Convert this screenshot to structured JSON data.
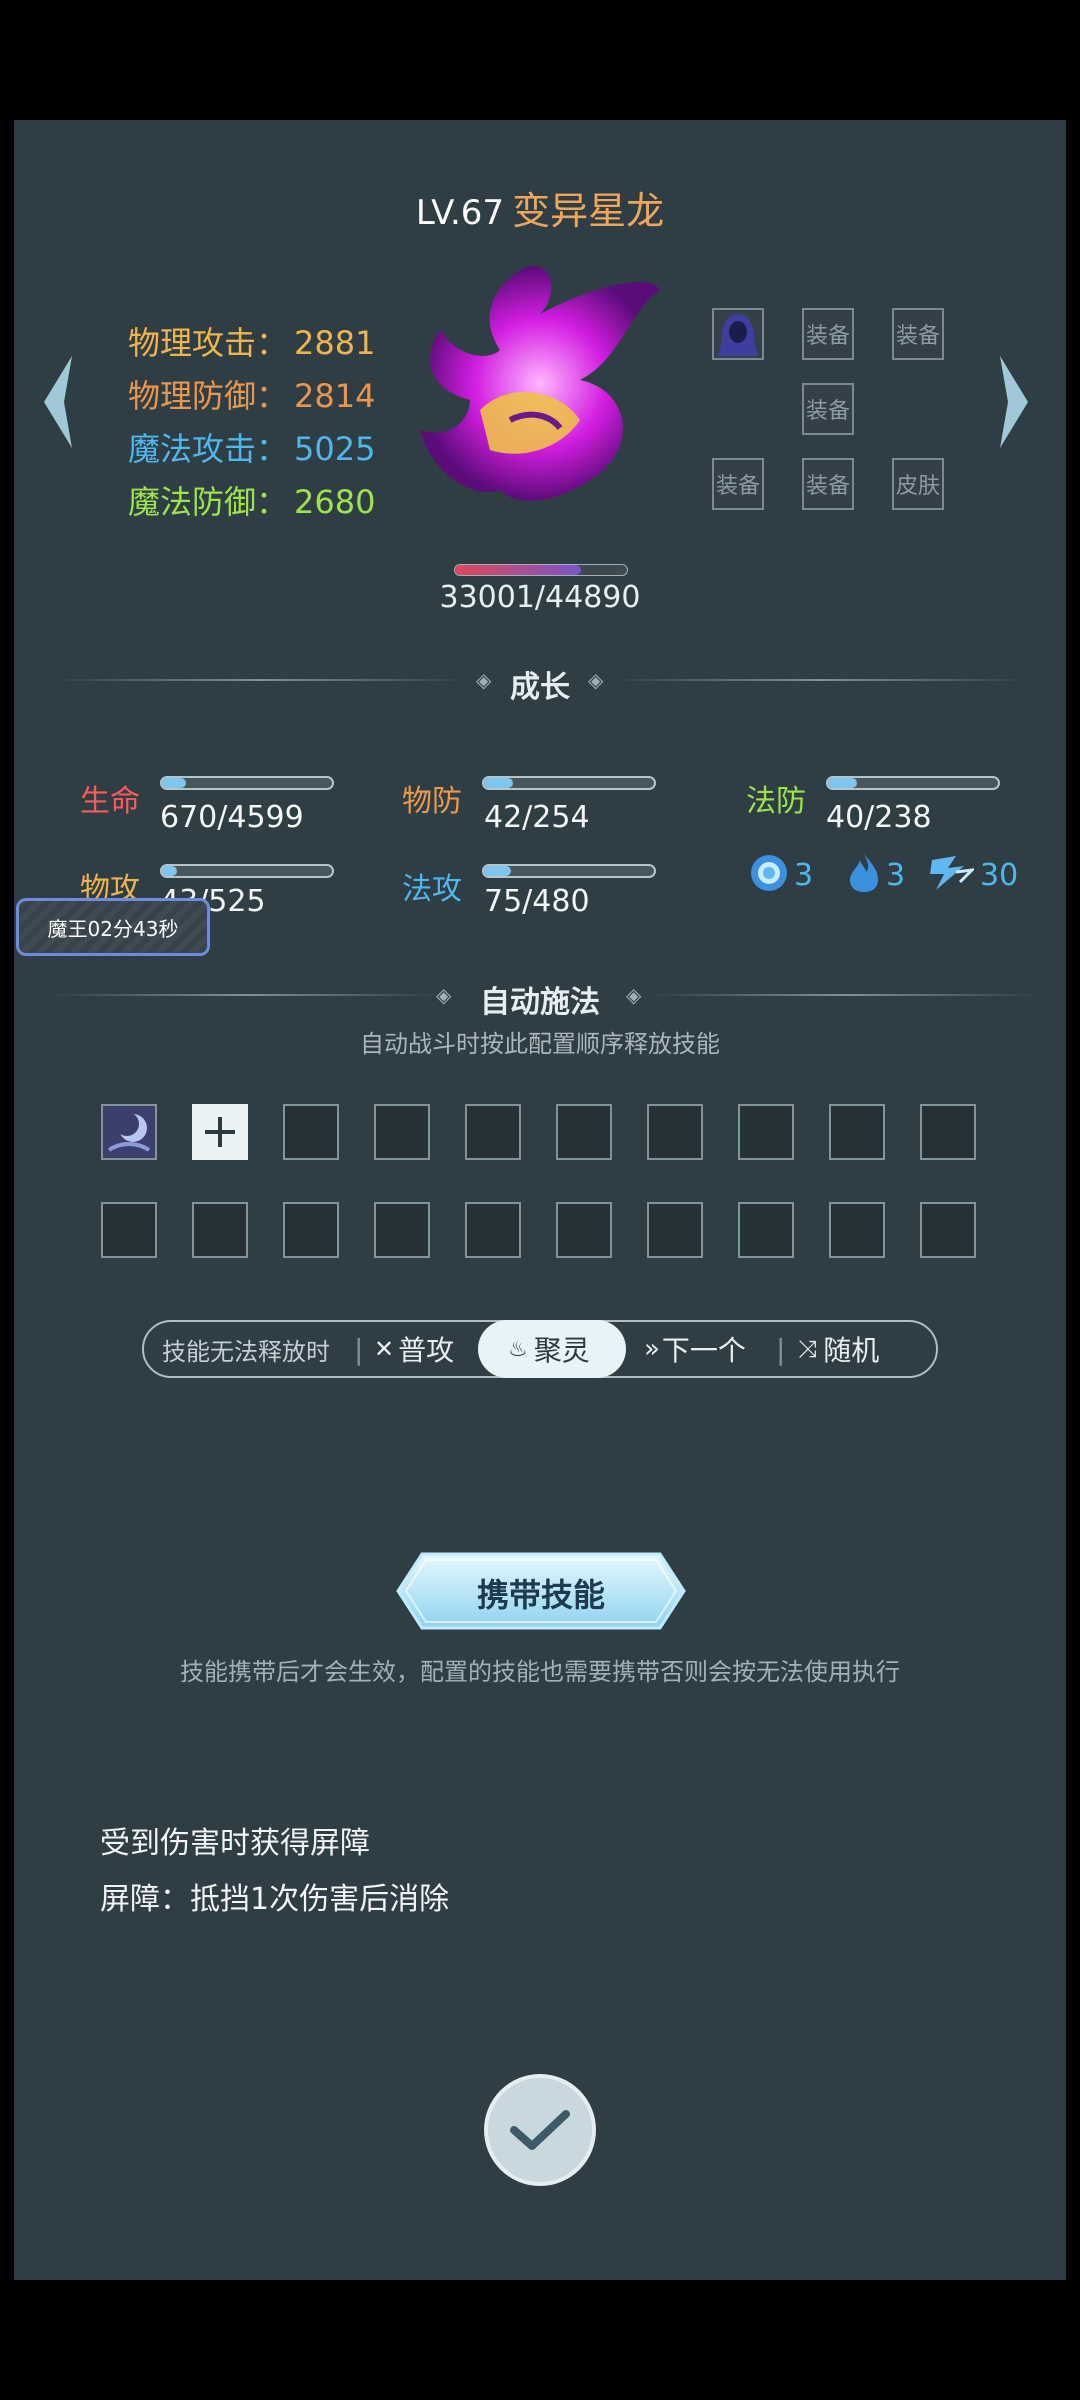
{
  "header": {
    "level": "LV.67",
    "pet_name": "变异星龙"
  },
  "stats": [
    {
      "label": "物理攻击：",
      "value": "2881",
      "color": "#f0b44c"
    },
    {
      "label": "物理防御：",
      "value": "2814",
      "color": "#e9964f"
    },
    {
      "label": "魔法攻击：",
      "value": "5025",
      "color": "#4eb8ec"
    },
    {
      "label": "魔法防御：",
      "value": "2680",
      "color": "#9ee24e"
    }
  ],
  "equipment": {
    "slot_label": "装备",
    "skin_label": "皮肤",
    "first_slot_partial": "备"
  },
  "hp": {
    "text": "33001/44890",
    "fraction": 0.735
  },
  "growth": {
    "title": "成长",
    "items": [
      {
        "label": "生命",
        "value": "670/4599",
        "fraction": 0.14,
        "color": "#ff5a5a"
      },
      {
        "label": "物防",
        "value": "42/254",
        "fraction": 0.17,
        "color": "#e99a4e"
      },
      {
        "label": "法防",
        "value": "40/238",
        "fraction": 0.17,
        "color": "#9ee24e"
      },
      {
        "label": "物攻",
        "value": "43/525",
        "fraction": 0.09,
        "color": "#f0b44c"
      },
      {
        "label": "法攻",
        "value": "75/480",
        "fraction": 0.16,
        "color": "#4eb8ec"
      }
    ],
    "resources": [
      {
        "icon": "blue-orb-icon",
        "value": "3"
      },
      {
        "icon": "blue-flame-icon",
        "value": "3"
      },
      {
        "icon": "lightning-feet-icon",
        "value": "30"
      }
    ]
  },
  "timer": {
    "text": "魔王02分43秒"
  },
  "auto_cast": {
    "title": "自动施法",
    "subtitle": "自动战斗时按此配置顺序释放技能"
  },
  "fallback": {
    "label": "技能无法释放时",
    "options": [
      "普攻",
      "聚灵",
      "下一个",
      "随机"
    ],
    "selected": "聚灵"
  },
  "carry": {
    "button": "携带技能",
    "hint": "技能携带后才会生效，配置的技能也需要携带否则会按无法使用执行"
  },
  "description": {
    "line1": "受到伤害时获得屏障",
    "line2": "屏障：抵挡1次伤害后消除"
  }
}
